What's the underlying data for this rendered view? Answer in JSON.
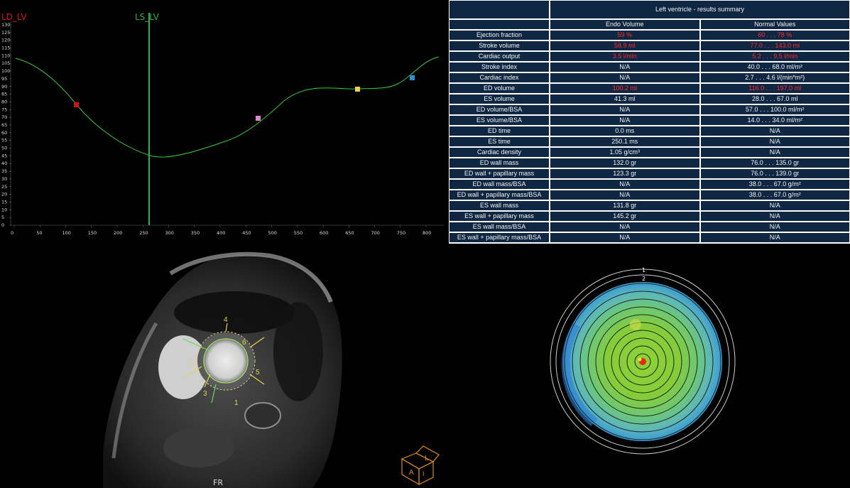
{
  "curve": {
    "ld_label": "LD_LV",
    "ls_label": "LS_LV",
    "y_ticks": [
      "130",
      "125",
      "120",
      "115",
      "110",
      "105",
      "100",
      "95",
      "90",
      "85",
      "80",
      "75",
      "70",
      "65",
      "60",
      "55",
      "50",
      "45",
      "40",
      "35",
      "30",
      "25",
      "20",
      "15",
      "10",
      "5",
      "0"
    ],
    "x_ticks": [
      "0",
      "50",
      "100",
      "150",
      "200",
      "250",
      "300",
      "350",
      "400",
      "450",
      "500",
      "550",
      "600",
      "650",
      "700",
      "750",
      "800"
    ],
    "colors": {
      "ld": "#d0141c",
      "ls": "#2bb24a",
      "curve": "#33cc33"
    }
  },
  "results": {
    "title": "Left ventricle - results summary",
    "col_endo": "Endo Volume",
    "col_normal": "Normal Values",
    "rows": [
      {
        "label": "Ejection fraction",
        "value": "59 %",
        "normal": "60 . . . 78 %",
        "red": true
      },
      {
        "label": "Stroke volume",
        "value": "58.9 ml",
        "normal": "77.0 . . . 143.0 ml",
        "red": true
      },
      {
        "label": "Cardiac output",
        "value": "3.5 l/min",
        "normal": "5.2 . . . 9.5 l/min",
        "red": true
      },
      {
        "label": "Stroke index",
        "value": "N/A",
        "normal": "40.0 . . . 68.0 ml/m²",
        "red": false
      },
      {
        "label": "Cardiac index",
        "value": "N/A",
        "normal": "2.7 . . . 4.6 l/(min*m²)",
        "red": false
      },
      {
        "label": "ED volume",
        "value": "100.2 ml",
        "normal": "116.0 . . . 197.0 ml",
        "red": true
      },
      {
        "label": "ES volume",
        "value": "41.3 ml",
        "normal": "28.0 . . . 67.0 ml",
        "red": false
      },
      {
        "label": "ED volume/BSA",
        "value": "N/A",
        "normal": "57.0 . . . 100.0 ml/m²",
        "red": false
      },
      {
        "label": "ES volume/BSA",
        "value": "N/A",
        "normal": "14.0 . . . 34.0 ml/m²",
        "red": false
      },
      {
        "label": "ED time",
        "value": "0.0 ms",
        "normal": "N/A",
        "red": false
      },
      {
        "label": "ES time",
        "value": "250.1 ms",
        "normal": "N/A",
        "red": false
      },
      {
        "label": "Cardiac density",
        "value": "1.05 g/cm³",
        "normal": "N/A",
        "red": false
      },
      {
        "label": "ED wall mass",
        "value": "132.0 gr",
        "normal": "76.0 . . . 135.0 gr",
        "red": false
      },
      {
        "label": "ED wall + papillary mass",
        "value": "123.3 gr",
        "normal": "76.0 . . . 139.0 gr",
        "red": false
      },
      {
        "label": "ED wall mass/BSA",
        "value": "N/A",
        "normal": "38.0 . . . 67.0 g/m²",
        "red": false
      },
      {
        "label": "ED wall + papillary mass/BSA",
        "value": "N/A",
        "normal": "38.0 . . . 67.0 g/m²",
        "red": false
      },
      {
        "label": "ES wall mass",
        "value": "131.8 gr",
        "normal": "N/A",
        "red": false
      },
      {
        "label": "ES wall + papillary mass",
        "value": "145.2 gr",
        "normal": "N/A",
        "red": false
      },
      {
        "label": "ES wall mass/BSA",
        "value": "N/A",
        "normal": "N/A",
        "red": false
      },
      {
        "label": "ES wall + papillary mass/BSA",
        "value": "N/A",
        "normal": "N/A",
        "red": false
      }
    ]
  },
  "mri": {
    "segment_labels": [
      "1",
      "2",
      "3",
      "4",
      "5",
      "6"
    ],
    "orientation_label": "FR",
    "cube_labels": {
      "front": "A",
      "side": "L",
      "top": "I"
    }
  },
  "bullseye": {
    "ring_labels": [
      "1",
      "2"
    ]
  }
}
